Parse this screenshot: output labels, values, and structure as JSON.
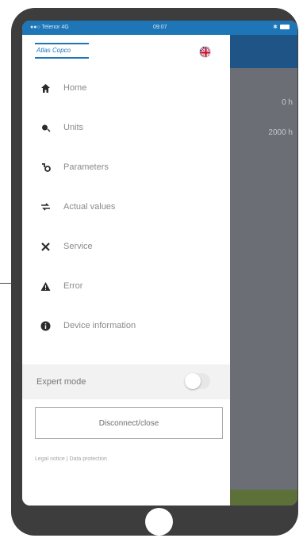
{
  "status_bar": {
    "carrier": "●●○ Telenor  4G",
    "time": "09:07",
    "right": "✱ ▮"
  },
  "header": {
    "logo_text": "Atlas Copco"
  },
  "menu": {
    "items": [
      {
        "label": "Home",
        "icon": "home-icon"
      },
      {
        "label": "Units",
        "icon": "units-icon"
      },
      {
        "label": "Parameters",
        "icon": "parameters-icon"
      },
      {
        "label": "Actual values",
        "icon": "actual-values-icon"
      },
      {
        "label": "Service",
        "icon": "service-icon"
      },
      {
        "label": "Error",
        "icon": "error-icon"
      },
      {
        "label": "Device information",
        "icon": "info-icon"
      }
    ]
  },
  "expert_mode": {
    "label": "Expert mode",
    "enabled": false
  },
  "disconnect_button": {
    "label": "Disconnect/close"
  },
  "footer": {
    "legal": "Legal notice | Data protection"
  },
  "background_values": {
    "v1": "0 h",
    "v2": "2000 h"
  },
  "colors": {
    "accent": "#1e76b7",
    "text": "#8a8a8a",
    "flag": "#c8102e"
  }
}
